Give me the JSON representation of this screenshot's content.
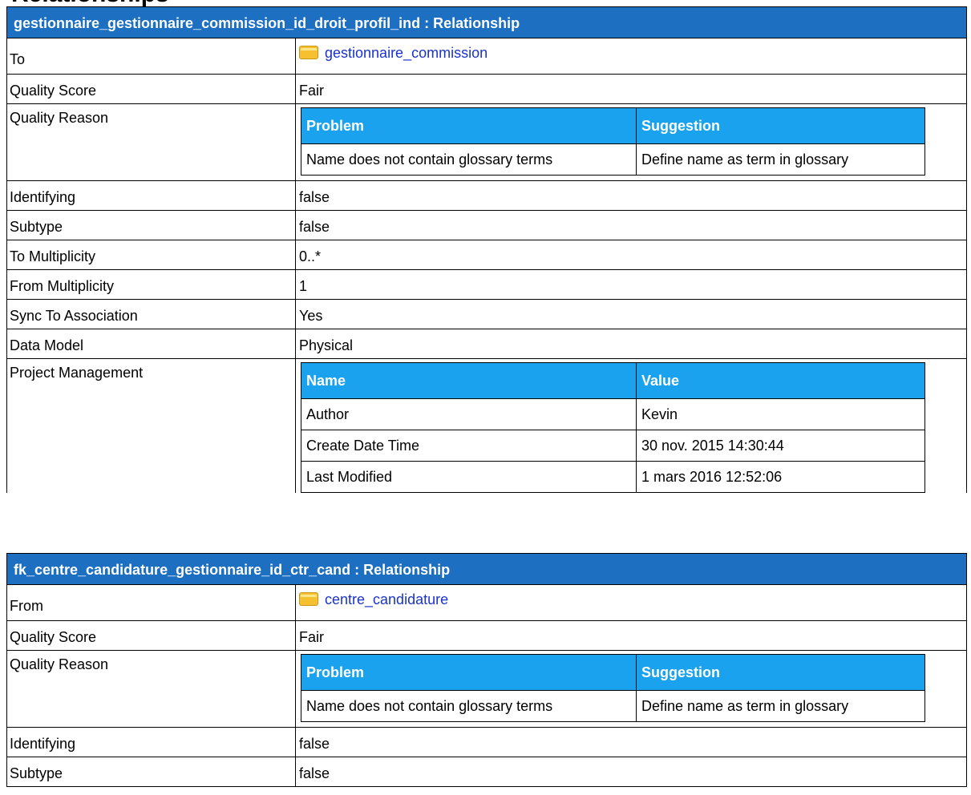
{
  "page_heading_partial": "Relationships",
  "relationships": [
    {
      "title": "gestionnaire_gestionnaire_commission_id_droit_profil_ind : Relationship",
      "link_label": "To",
      "link_target": "gestionnaire_commission",
      "quality_score_label": "Quality Score",
      "quality_score": "Fair",
      "quality_reason_label": "Quality Reason",
      "quality_headers": [
        "Problem",
        "Suggestion"
      ],
      "quality_rows": [
        [
          "Name does not contain glossary terms",
          "Define name as term in glossary"
        ]
      ],
      "identifying_label": "Identifying",
      "identifying": "false",
      "subtype_label": "Subtype",
      "subtype": "false",
      "to_multiplicity_label": "To Multiplicity",
      "to_multiplicity": "0..*",
      "from_multiplicity_label": "From Multiplicity",
      "from_multiplicity": "1",
      "sync_label": "Sync To Association",
      "sync": "Yes",
      "data_model_label": "Data Model",
      "data_model": "Physical",
      "pm_label": "Project Management",
      "pm_headers": [
        "Name",
        "Value"
      ],
      "pm_rows": [
        [
          "Author",
          "Kevin"
        ],
        [
          "Create Date Time",
          "30 nov. 2015 14:30:44"
        ],
        [
          "Last Modified",
          "1 mars 2016 12:52:06"
        ]
      ]
    },
    {
      "title": "fk_centre_candidature_gestionnaire_id_ctr_cand : Relationship",
      "link_label": "From",
      "link_target": "centre_candidature",
      "quality_score_label": "Quality Score",
      "quality_score": "Fair",
      "quality_reason_label": "Quality Reason",
      "quality_headers": [
        "Problem",
        "Suggestion"
      ],
      "quality_rows": [
        [
          "Name does not contain glossary terms",
          "Define name as term in glossary"
        ]
      ],
      "identifying_label": "Identifying",
      "identifying": "false",
      "subtype_label": "Subtype",
      "subtype": "false"
    }
  ],
  "icons": {
    "entity_link": "folder-icon"
  },
  "colors": {
    "section_header": "#1d6fc2",
    "table_header": "#1aa2ef",
    "link": "#1a33cc"
  }
}
